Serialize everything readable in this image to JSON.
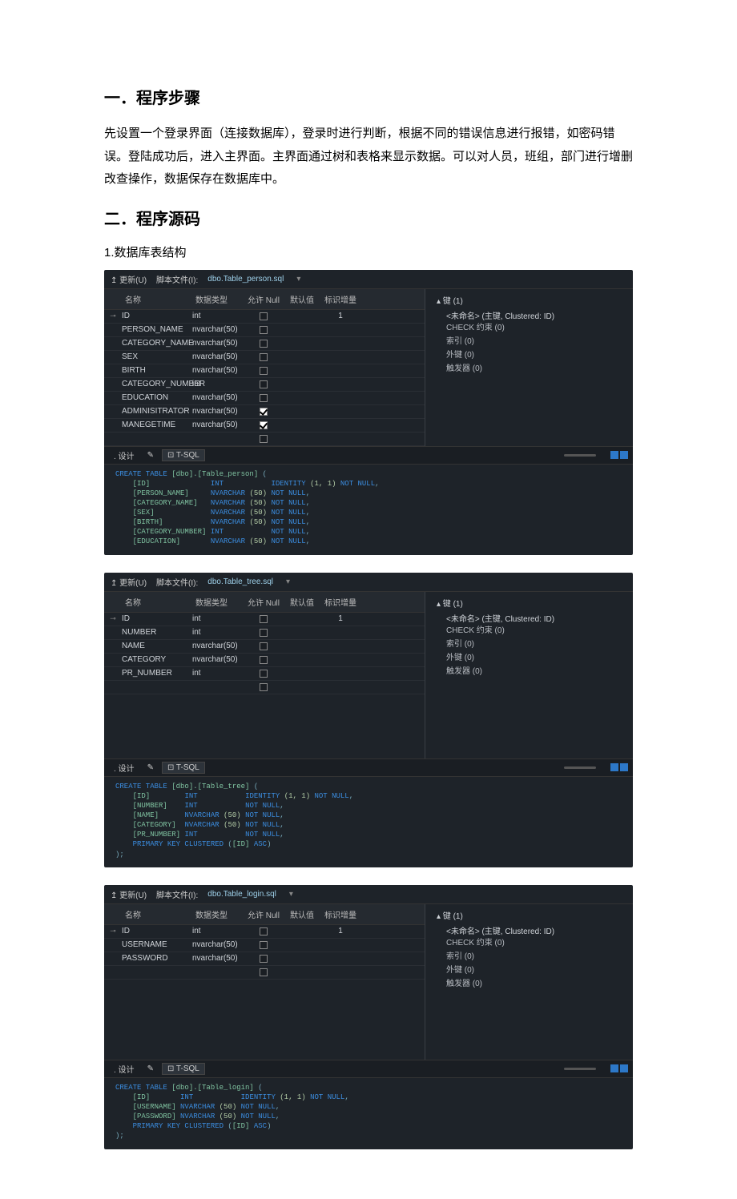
{
  "headings": {
    "h1": "一．程序步骤",
    "description": "先设置一个登录界面（连接数据库），登录时进行判断，根据不同的错误信息进行报错，如密码错误。登陆成功后，进入主界面。主界面通过树和表格来显示数据。可以对人员，班组，部门进行增删改查操作，数据保存在数据库中。",
    "h2": "二．程序源码",
    "sub1": "1.数据库表结构"
  },
  "labels": {
    "update": "更新(U)",
    "scriptfile": "脚本文件(I):",
    "col_name": "名称",
    "col_type": "数据类型",
    "col_null": "允许 Null",
    "col_def": "默认值",
    "col_id": "标识增量",
    "tab_design": "设计",
    "tab_tsql": "T-SQL",
    "key_header": "键 (1)",
    "pk_line": "<未命名>  (主键, Clustered: ID)",
    "check": "CHECK 约束 (0)",
    "index": "索引 (0)",
    "fk": "外键 (0)",
    "trigger": "触发器 (0)"
  },
  "tables": [
    {
      "file": "dbo.Table_person.sql",
      "columns": [
        {
          "pk": true,
          "name": "ID",
          "type": "int",
          "nullable": false,
          "identity": "1"
        },
        {
          "pk": false,
          "name": "PERSON_NAME",
          "type": "nvarchar(50)",
          "nullable": false,
          "identity": ""
        },
        {
          "pk": false,
          "name": "CATEGORY_NAME",
          "type": "nvarchar(50)",
          "nullable": false,
          "identity": ""
        },
        {
          "pk": false,
          "name": "SEX",
          "type": "nvarchar(50)",
          "nullable": false,
          "identity": ""
        },
        {
          "pk": false,
          "name": "BIRTH",
          "type": "nvarchar(50)",
          "nullable": false,
          "identity": ""
        },
        {
          "pk": false,
          "name": "CATEGORY_NUMBER",
          "type": "int",
          "nullable": false,
          "identity": ""
        },
        {
          "pk": false,
          "name": "EDUCATION",
          "type": "nvarchar(50)",
          "nullable": false,
          "identity": ""
        },
        {
          "pk": false,
          "name": "ADMINISITRATOR",
          "type": "nvarchar(50)",
          "nullable": true,
          "identity": ""
        },
        {
          "pk": false,
          "name": "MANEGETIME",
          "type": "nvarchar(50)",
          "nullable": true,
          "identity": ""
        }
      ],
      "sql": "CREATE TABLE [dbo].[Table_person] (\n    [ID]              INT           IDENTITY (1, 1) NOT NULL,\n    [PERSON_NAME]     NVARCHAR (50) NOT NULL,\n    [CATEGORY_NAME]   NVARCHAR (50) NOT NULL,\n    [SEX]             NVARCHAR (50) NOT NULL,\n    [BIRTH]           NVARCHAR (50) NOT NULL,\n    [CATEGORY_NUMBER] INT           NOT NULL,\n    [EDUCATION]       NVARCHAR (50) NOT NULL,"
    },
    {
      "file": "dbo.Table_tree.sql",
      "columns": [
        {
          "pk": true,
          "name": "ID",
          "type": "int",
          "nullable": false,
          "identity": "1"
        },
        {
          "pk": false,
          "name": "NUMBER",
          "type": "int",
          "nullable": false,
          "identity": ""
        },
        {
          "pk": false,
          "name": "NAME",
          "type": "nvarchar(50)",
          "nullable": false,
          "identity": ""
        },
        {
          "pk": false,
          "name": "CATEGORY",
          "type": "nvarchar(50)",
          "nullable": false,
          "identity": ""
        },
        {
          "pk": false,
          "name": "PR_NUMBER",
          "type": "int",
          "nullable": false,
          "identity": ""
        }
      ],
      "sql": "CREATE TABLE [dbo].[Table_tree] (\n    [ID]        INT           IDENTITY (1, 1) NOT NULL,\n    [NUMBER]    INT           NOT NULL,\n    [NAME]      NVARCHAR (50) NOT NULL,\n    [CATEGORY]  NVARCHAR (50) NOT NULL,\n    [PR_NUMBER] INT           NOT NULL,\n    PRIMARY KEY CLUSTERED ([ID] ASC)\n);"
    },
    {
      "file": "dbo.Table_login.sql",
      "columns": [
        {
          "pk": true,
          "name": "ID",
          "type": "int",
          "nullable": false,
          "identity": "1"
        },
        {
          "pk": false,
          "name": "USERNAME",
          "type": "nvarchar(50)",
          "nullable": false,
          "identity": ""
        },
        {
          "pk": false,
          "name": "PASSWORD",
          "type": "nvarchar(50)",
          "nullable": false,
          "identity": ""
        }
      ],
      "sql": "CREATE TABLE [dbo].[Table_login] (\n    [ID]       INT           IDENTITY (1, 1) NOT NULL,\n    [USERNAME] NVARCHAR (50) NOT NULL,\n    [PASSWORD] NVARCHAR (50) NOT NULL,\n    PRIMARY KEY CLUSTERED ([ID] ASC)\n);"
    }
  ]
}
